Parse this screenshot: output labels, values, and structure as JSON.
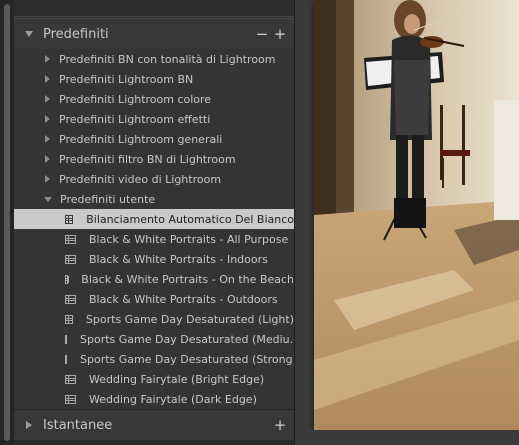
{
  "panel": {
    "title": "Predefiniti",
    "minus": "−",
    "plus": "+",
    "folders": [
      "Predefiniti BN con tonalità di Lightroom",
      "Predefiniti Lightroom BN",
      "Predefiniti Lightroom colore",
      "Predefiniti Lightroom effetti",
      "Predefiniti Lightroom generali",
      "Predefiniti filtro BN di Lightroom",
      "Predefiniti video di Lightroom",
      "Predefiniti utente"
    ],
    "user_presets": [
      "Bilanciamento Automatico Del Bianco",
      "Black & White Portraits - All Purpose",
      "Black & White Portraits - Indoors",
      "Black & White Portraits - On the Beach",
      "Black & White Portraits - Outdoors",
      "Sports Game Day Desaturated (Light)",
      "Sports Game Day Desaturated (Mediu...",
      "Sports Game Day Desaturated (Strong)",
      "Wedding Fairytale (Bright Edge)",
      "Wedding Fairytale (Dark Edge)"
    ],
    "selected_preset": "Bilanciamento Automatico Del Bianco"
  },
  "snapshots": {
    "title": "Istantanee",
    "plus": "+"
  },
  "icons": {
    "expanded": "triangle-down",
    "collapsed": "triangle-right",
    "preset": "preset-list-icon"
  },
  "colors": {
    "panel_bg": "#343434",
    "selected_row": "#c9c9c9",
    "text": "#c8c8c8"
  }
}
